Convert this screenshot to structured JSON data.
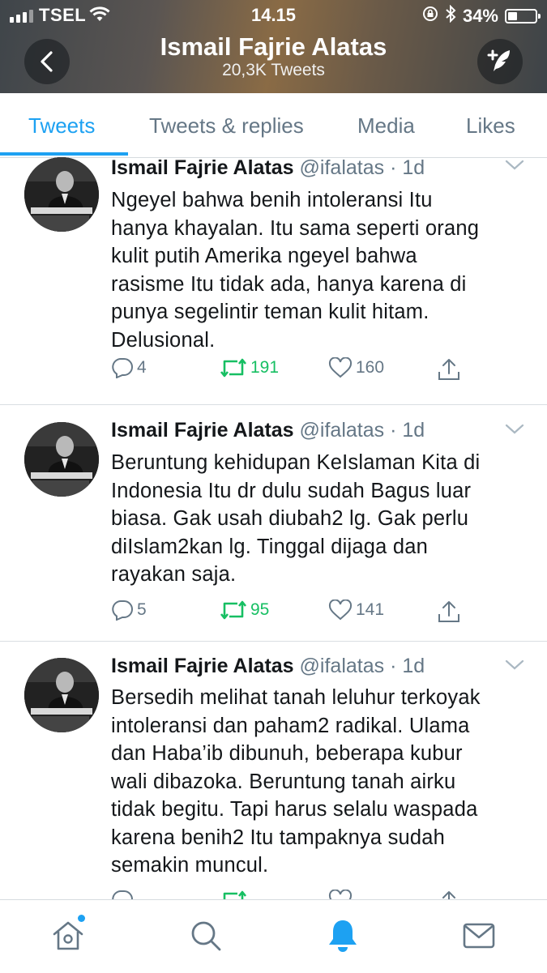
{
  "status_bar": {
    "carrier": "TSEL",
    "time": "14.15",
    "battery_percent": "34%",
    "battery_level": 0.34
  },
  "header": {
    "title": "Ismail Fajrie Alatas",
    "subtitle": "20,3K Tweets",
    "back_icon": "back-arrow-icon",
    "compose_icon": "compose-tweet-icon"
  },
  "tabs": [
    {
      "label": "Tweets",
      "active": true
    },
    {
      "label": "Tweets & replies",
      "active": false
    },
    {
      "label": "Media",
      "active": false
    },
    {
      "label": "Likes",
      "active": false
    }
  ],
  "tweets": [
    {
      "name": "Ismail Fajrie Alatas",
      "handle": "@ifalatas",
      "time": "· 1d",
      "lines": [
        "Ngeyel bahwa benih intoleransi Itu",
        "hanya khayalan. Itu sama seperti orang",
        "kulit putih Amerika ngeyel bahwa",
        "rasisme Itu tidak ada, hanya karena di",
        "punya segelintir teman kulit hitam.",
        "Delusional."
      ],
      "replies": "4",
      "retweets": "191",
      "likes": "160"
    },
    {
      "name": "Ismail Fajrie Alatas",
      "handle": "@ifalatas",
      "time": "· 1d",
      "lines": [
        "Beruntung kehidupan KeIslaman Kita di",
        "Indonesia Itu dr dulu sudah Bagus luar",
        "biasa. Gak usah diubah2 lg. Gak perlu",
        "diIslam2kan lg. Tinggal dijaga dan",
        "rayakan saja."
      ],
      "replies": "5",
      "retweets": "95",
      "likes": "141"
    },
    {
      "name": "Ismail Fajrie Alatas",
      "handle": "@ifalatas",
      "time": "· 1d",
      "lines": [
        "Bersedih melihat tanah leluhur terkoyak",
        "intoleransi dan paham2 radikal. Ulama",
        "dan Haba’ib dibunuh, beberapa kubur",
        "wali dibazoka. Beruntung tanah airku",
        "tidak begitu. Tapi harus selalu waspada",
        "karena benih2 Itu tampaknya sudah",
        "semakin muncul."
      ],
      "replies": "",
      "retweets": "",
      "likes": ""
    }
  ],
  "bottom_nav": [
    {
      "icon": "home-icon",
      "active": false,
      "badge": true
    },
    {
      "icon": "search-icon",
      "active": false
    },
    {
      "icon": "notifications-bell-icon",
      "active": true
    },
    {
      "icon": "messages-envelope-icon",
      "active": false
    }
  ],
  "colors": {
    "accent": "#1da1f2",
    "retweet_green": "#17bf63",
    "secondary_text": "#657786"
  }
}
